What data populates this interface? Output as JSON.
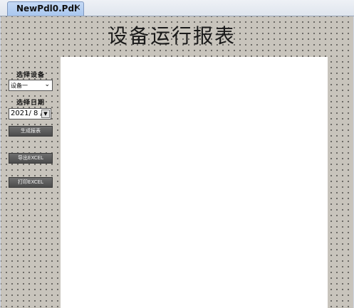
{
  "tab": {
    "title": "NewPdl0.Pdl",
    "close_symbol": "✕"
  },
  "report": {
    "title": "设备运行报表"
  },
  "controls": {
    "device_label": "选择设备",
    "device_selected": "设备一",
    "date_label": "选择日期",
    "date_value": "2021/ 8 /",
    "generate_button": "生成报表",
    "export_button": "导出EXCEL",
    "print_button": "打印EXCEL"
  }
}
